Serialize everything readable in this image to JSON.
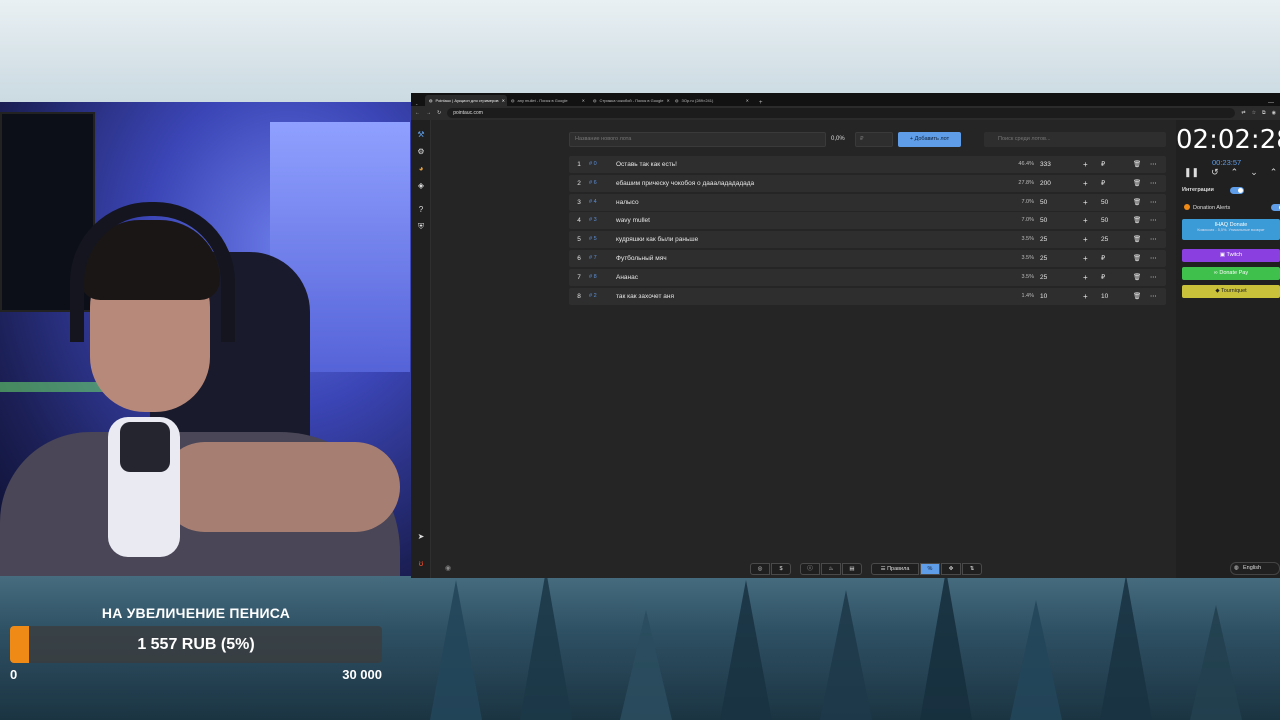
{
  "browser": {
    "tabs": [
      {
        "title": "Pointauc | Аукцион для стримеров",
        "active": true
      },
      {
        "title": "any mullet - Поиск в Google",
        "active": false
      },
      {
        "title": "Стрижка чокобой - Поиск в Google",
        "active": false
      },
      {
        "title": "ЗОр.ru (289×241)",
        "active": false
      }
    ],
    "url": "pointauc.com"
  },
  "auction": {
    "lot_placeholder": "Название нового лота",
    "percent": "0,0%",
    "currency_placeholder": "₽",
    "add_button": "Добавить лот",
    "search_placeholder": "Поиск среди лотов...",
    "lots": [
      {
        "num": "1",
        "id": "# 0",
        "name": "Оставь так как есть!",
        "pct": "46.4%",
        "amount": "333",
        "add": "₽"
      },
      {
        "num": "2",
        "id": "# 6",
        "name": "ебашим прическу чокобоя о даааладададада",
        "pct": "27.8%",
        "amount": "200",
        "add": "₽"
      },
      {
        "num": "3",
        "id": "# 4",
        "name": "налысо",
        "pct": "7.0%",
        "amount": "50",
        "add": "50"
      },
      {
        "num": "4",
        "id": "# 3",
        "name": "wavy mullet",
        "pct": "7.0%",
        "amount": "50",
        "add": "50"
      },
      {
        "num": "5",
        "id": "# 5",
        "name": "кудряшки как были раньше",
        "pct": "3.5%",
        "amount": "25",
        "add": "25"
      },
      {
        "num": "6",
        "id": "# 7",
        "name": "Футбольный мяч",
        "pct": "3.5%",
        "amount": "25",
        "add": "₽"
      },
      {
        "num": "7",
        "id": "# 8",
        "name": "Ананас",
        "pct": "3.5%",
        "amount": "25",
        "add": "₽"
      },
      {
        "num": "8",
        "id": "# 2",
        "name": "так как захочет аня",
        "pct": "1.4%",
        "amount": "10",
        "add": "10"
      }
    ]
  },
  "panel": {
    "timer": "02:02:28",
    "subtimer": "00:23:57",
    "integrations_label": "Интеграции",
    "donation_alerts": "Donation Alerts",
    "ihaq": {
      "title": "IHAQ Donate",
      "subtitle": "Комиссия - 5,5%. Уникальные возврат"
    },
    "twitch": "Twitch",
    "donatepay": "Donate Pay",
    "tourniquet": "Tourniquet",
    "language": "English"
  },
  "toolbar": {
    "rules": "Правила"
  },
  "goal": {
    "title": "НА УВЕЛИЧЕНИЕ ПЕНИСА",
    "progress_text": "1 557 RUB (5%)",
    "progress": 0.05,
    "min": "0",
    "max": "30 000"
  },
  "colors": {
    "accent": "#5f9de8",
    "goal_fill": "#f08a16",
    "twitch": "#8a3fe0",
    "donatepay": "#3fbf4c",
    "tourniquet": "#c9c13a",
    "ihaq": "#3b9bd6"
  }
}
